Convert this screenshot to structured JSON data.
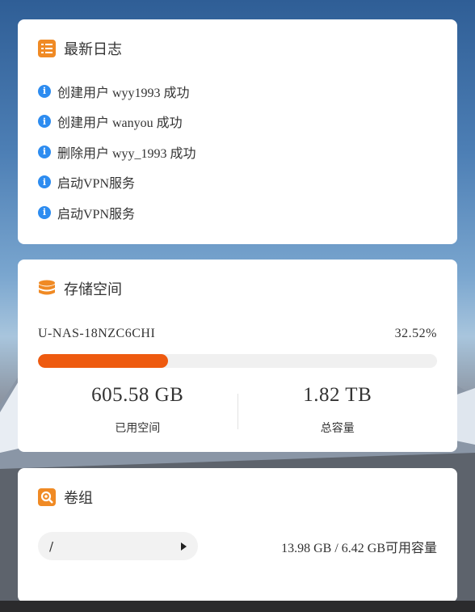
{
  "logs": {
    "title": "最新日志",
    "items": [
      {
        "text": "创建用户 wyy1993 成功"
      },
      {
        "text": "创建用户 wanyou 成功"
      },
      {
        "text": "删除用户 wyy_1993 成功"
      },
      {
        "text": "启动VPN服务"
      },
      {
        "text": "启动VPN服务"
      }
    ]
  },
  "storage": {
    "title": "存储空间",
    "device": "U-NAS-18NZC6CHI",
    "percent_label": "32.52%",
    "usage_fraction": 0.3252,
    "used_value": "605.58 GB",
    "used_label": "已用空间",
    "total_value": "1.82 TB",
    "total_label": "总容量"
  },
  "volume": {
    "title": "卷组",
    "selected": "/",
    "capacity_text": "13.98 GB / 6.42 GB可用容量"
  },
  "colors": {
    "accent": "#ee5a0f",
    "icon_orange": "#f08a24",
    "info_blue": "#2d8cf0"
  }
}
